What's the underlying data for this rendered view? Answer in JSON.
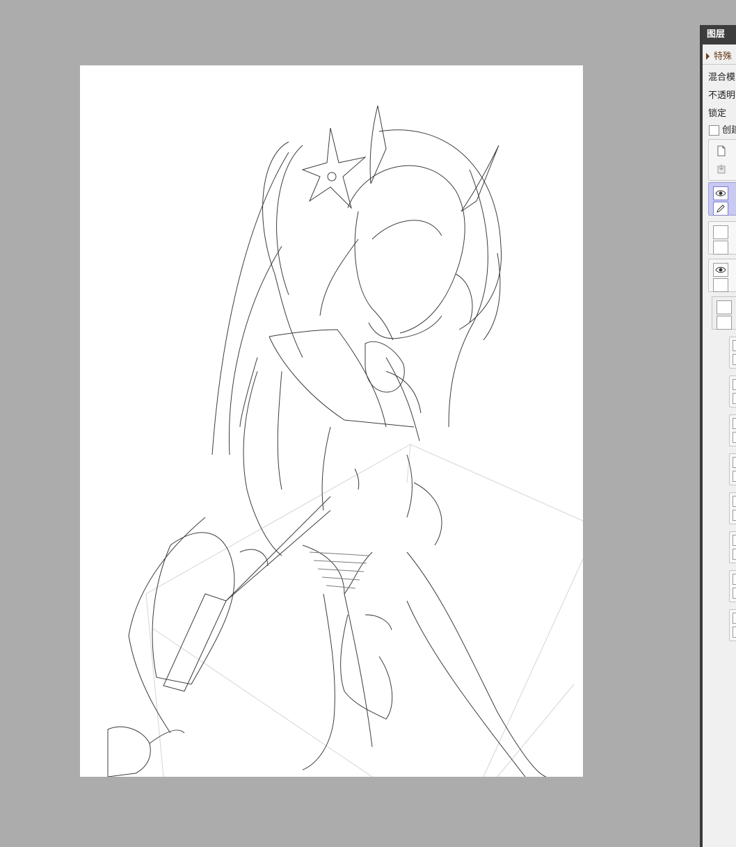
{
  "layer_panel": {
    "title": "图层",
    "special_section": "特殊",
    "blend_mode_label": "混合模",
    "opacity_label": "不透明",
    "lock_label": "锁定",
    "create_clip_label": "创建",
    "layers": [
      {
        "visible": true,
        "editable": true,
        "selected": true
      },
      {
        "visible": false,
        "editable": false,
        "selected": false
      },
      {
        "visible": true,
        "editable": false,
        "selected": false
      },
      {
        "visible": false,
        "editable": false,
        "selected": false,
        "group": true
      }
    ],
    "sub_layer_count": 8
  },
  "colors": {
    "canvas_bg": "#acacac",
    "paper": "#ffffff",
    "panel_bg": "#f0f0f0",
    "titlebar": "#3d3d3d",
    "selected_layer": "#c9c9f2",
    "section_text": "#6a3a1c"
  }
}
